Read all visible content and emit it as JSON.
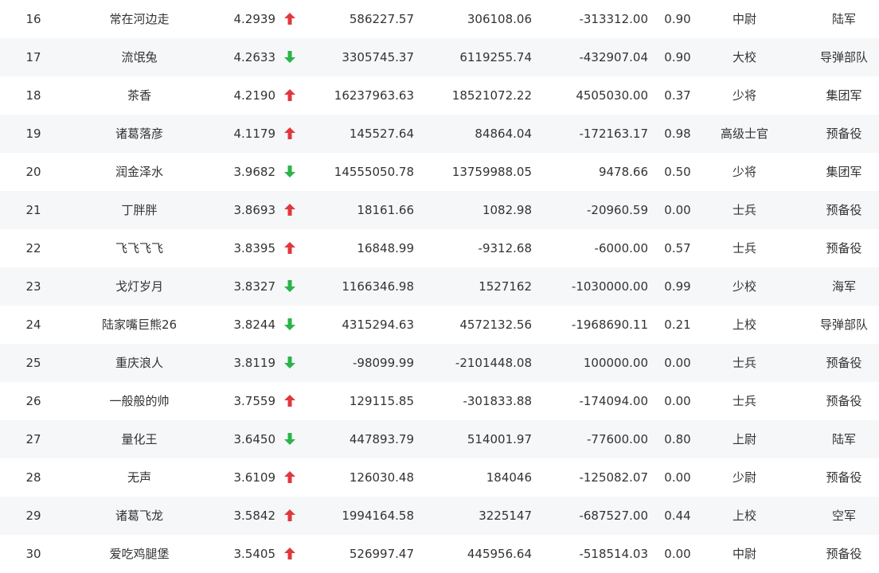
{
  "colors": {
    "up_arrow": "#e0383e",
    "down_arrow": "#2cb34a",
    "text": "#333333",
    "row_alt": "#f6f7f9"
  },
  "rows": [
    {
      "rank": "16",
      "name": "常在河边走",
      "score": "4.2939",
      "trend": "up",
      "v1": "586227.57",
      "v2": "306108.06",
      "v3": "-313312.00",
      "ratio": "0.90",
      "title": "中尉",
      "branch": "陆军"
    },
    {
      "rank": "17",
      "name": "流氓兔",
      "score": "4.2633",
      "trend": "down",
      "v1": "3305745.37",
      "v2": "6119255.74",
      "v3": "-432907.04",
      "ratio": "0.90",
      "title": "大校",
      "branch": "导弹部队"
    },
    {
      "rank": "18",
      "name": "茶香",
      "score": "4.2190",
      "trend": "up",
      "v1": "16237963.63",
      "v2": "18521072.22",
      "v3": "4505030.00",
      "ratio": "0.37",
      "title": "少将",
      "branch": "集团军"
    },
    {
      "rank": "19",
      "name": "诸葛落彦",
      "score": "4.1179",
      "trend": "up",
      "v1": "145527.64",
      "v2": "84864.04",
      "v3": "-172163.17",
      "ratio": "0.98",
      "title": "高级士官",
      "branch": "预备役"
    },
    {
      "rank": "20",
      "name": "润金泽水",
      "score": "3.9682",
      "trend": "down",
      "v1": "14555050.78",
      "v2": "13759988.05",
      "v3": "9478.66",
      "ratio": "0.50",
      "title": "少将",
      "branch": "集团军"
    },
    {
      "rank": "21",
      "name": "丁胖胖",
      "score": "3.8693",
      "trend": "up",
      "v1": "18161.66",
      "v2": "1082.98",
      "v3": "-20960.59",
      "ratio": "0.00",
      "title": "士兵",
      "branch": "预备役"
    },
    {
      "rank": "22",
      "name": "飞飞飞飞",
      "score": "3.8395",
      "trend": "up",
      "v1": "16848.99",
      "v2": "-9312.68",
      "v3": "-6000.00",
      "ratio": "0.57",
      "title": "士兵",
      "branch": "预备役"
    },
    {
      "rank": "23",
      "name": "戈灯岁月",
      "score": "3.8327",
      "trend": "down",
      "v1": "1166346.98",
      "v2": "1527162",
      "v3": "-1030000.00",
      "ratio": "0.99",
      "title": "少校",
      "branch": "海军"
    },
    {
      "rank": "24",
      "name": "陆家嘴巨熊26",
      "score": "3.8244",
      "trend": "down",
      "v1": "4315294.63",
      "v2": "4572132.56",
      "v3": "-1968690.11",
      "ratio": "0.21",
      "title": "上校",
      "branch": "导弹部队"
    },
    {
      "rank": "25",
      "name": "重庆浪人",
      "score": "3.8119",
      "trend": "down",
      "v1": "-98099.99",
      "v2": "-2101448.08",
      "v3": "100000.00",
      "ratio": "0.00",
      "title": "士兵",
      "branch": "预备役"
    },
    {
      "rank": "26",
      "name": "一般般的帅",
      "score": "3.7559",
      "trend": "up",
      "v1": "129115.85",
      "v2": "-301833.88",
      "v3": "-174094.00",
      "ratio": "0.00",
      "title": "士兵",
      "branch": "预备役"
    },
    {
      "rank": "27",
      "name": "量化王",
      "score": "3.6450",
      "trend": "down",
      "v1": "447893.79",
      "v2": "514001.97",
      "v3": "-77600.00",
      "ratio": "0.80",
      "title": "上尉",
      "branch": "陆军"
    },
    {
      "rank": "28",
      "name": "无声",
      "score": "3.6109",
      "trend": "up",
      "v1": "126030.48",
      "v2": "184046",
      "v3": "-125082.07",
      "ratio": "0.00",
      "title": "少尉",
      "branch": "预备役"
    },
    {
      "rank": "29",
      "name": "诸葛飞龙",
      "score": "3.5842",
      "trend": "up",
      "v1": "1994164.58",
      "v2": "3225147",
      "v3": "-687527.00",
      "ratio": "0.44",
      "title": "上校",
      "branch": "空军"
    },
    {
      "rank": "30",
      "name": "爱吃鸡腿堡",
      "score": "3.5405",
      "trend": "up",
      "v1": "526997.47",
      "v2": "445956.64",
      "v3": "-518514.03",
      "ratio": "0.00",
      "title": "中尉",
      "branch": "预备役"
    }
  ]
}
